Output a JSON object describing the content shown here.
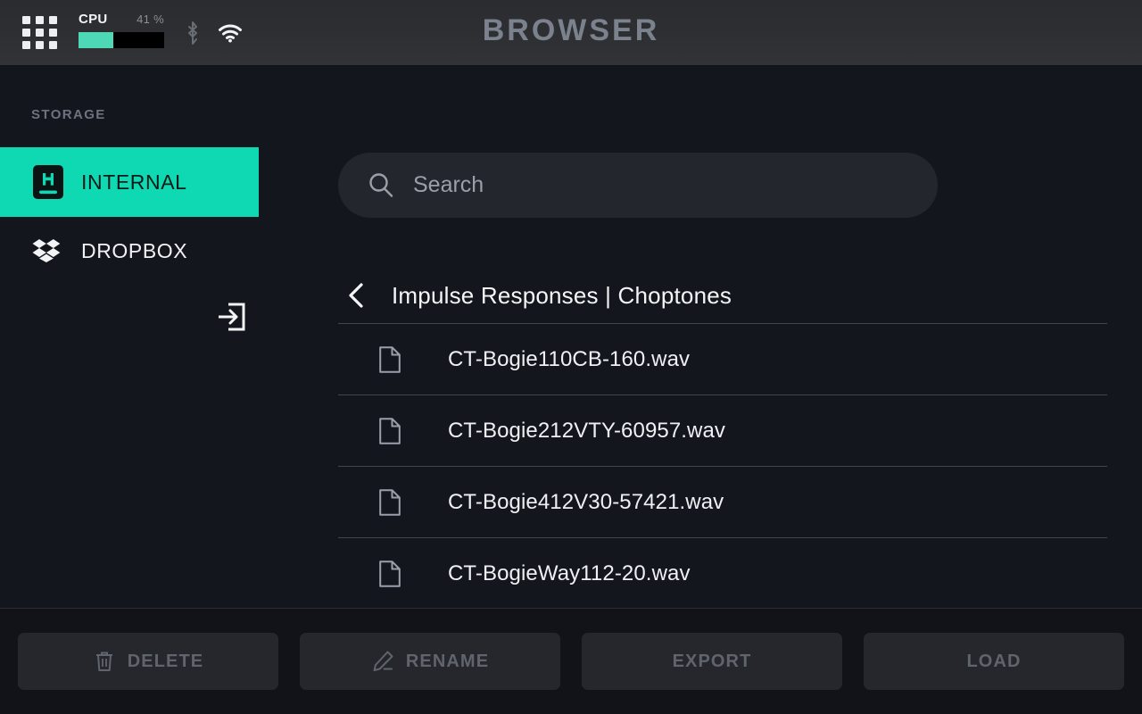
{
  "statusbar": {
    "menu_icon": "apps-grid-icon",
    "cpu": {
      "label": "CPU",
      "value": "41 %",
      "percent": 41,
      "icon": "cpu-meter"
    },
    "bluetooth": {
      "icon": "bluetooth-icon",
      "active": false
    },
    "wifi": {
      "icon": "wifi-icon",
      "active": true
    }
  },
  "header": {
    "title": "BROWSER"
  },
  "sidebar": {
    "section_label": "STORAGE",
    "items": [
      {
        "label": "INTERNAL",
        "icon": "internal-storage-icon",
        "selected": true
      },
      {
        "label": "DROPBOX",
        "icon": "dropbox-icon",
        "selected": false,
        "action_icon": "login-arrow-icon"
      }
    ]
  },
  "search": {
    "placeholder": "Search",
    "value": "",
    "icon": "search-icon"
  },
  "breadcrumb": {
    "back_icon": "chevron-left-icon",
    "path": "Impulse Responses | Choptones"
  },
  "file_list": {
    "item_icon": "file-icon",
    "items": [
      {
        "name": "CT-Bogie110CB-160.wav"
      },
      {
        "name": "CT-Bogie212VTY-60957.wav"
      },
      {
        "name": "CT-Bogie412V30-57421.wav"
      },
      {
        "name": "CT-BogieWay112-20.wav"
      }
    ]
  },
  "actions": [
    {
      "label": "DELETE",
      "icon": "trash-icon",
      "enabled": false
    },
    {
      "label": "RENAME",
      "icon": "pencil-icon",
      "enabled": false
    },
    {
      "label": "EXPORT",
      "icon": null,
      "enabled": false
    },
    {
      "label": "LOAD",
      "icon": null,
      "enabled": false
    }
  ],
  "colors": {
    "accent": "#0fd9b2",
    "accent_cpu": "#4dd9b6",
    "background": "#14161e",
    "topbar": "#2d2f32",
    "panel": "#23262d",
    "button": "#25272d",
    "divider": "#41454e",
    "title_text": "#7b828d",
    "muted_text": "#5f646d"
  }
}
